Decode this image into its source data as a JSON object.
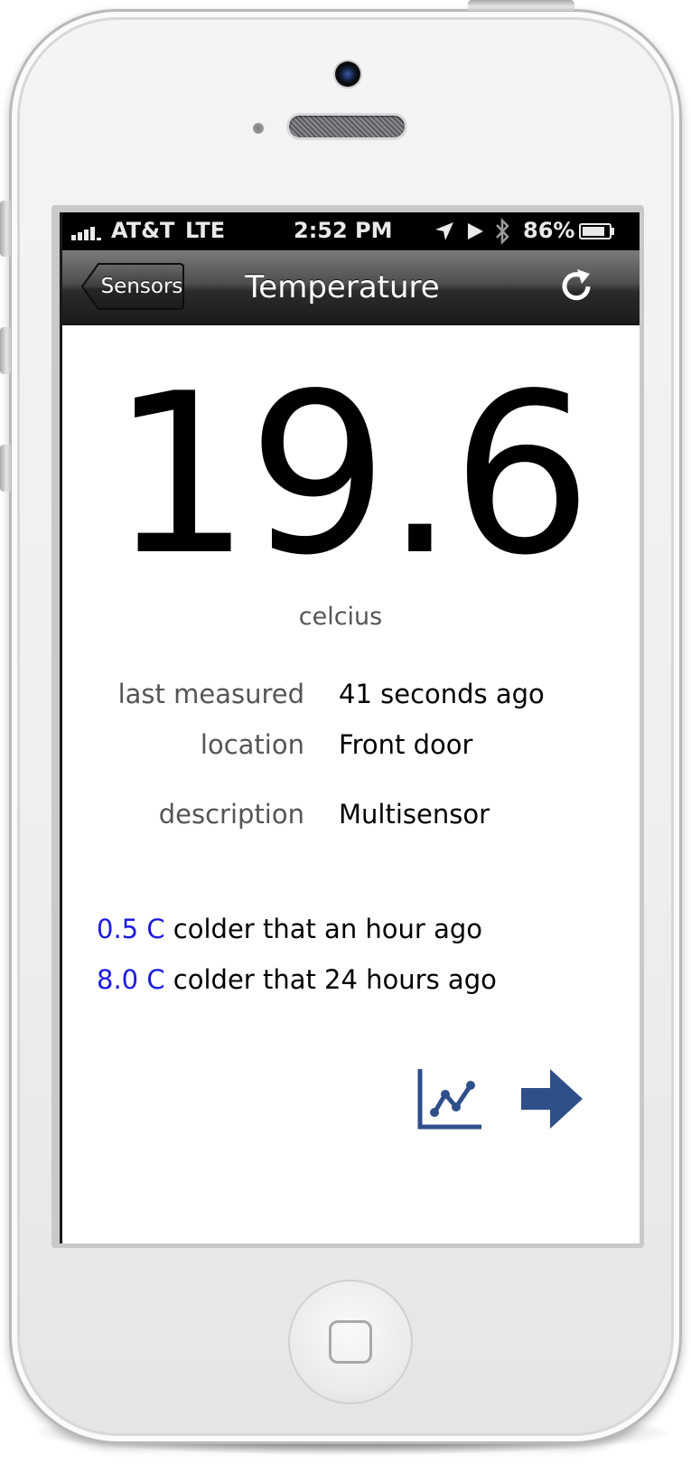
{
  "status_bar": {
    "carrier": "AT&T",
    "network": "LTE",
    "time": "2:52 PM",
    "battery_percent": "86%",
    "battery_level": 0.86,
    "signal_bars": 4,
    "icons": [
      "location-arrow-icon",
      "play-icon",
      "bluetooth-icon",
      "battery-icon"
    ]
  },
  "nav": {
    "back_label": "Sensors",
    "title": "Temperature",
    "refresh_icon": "refresh-icon"
  },
  "sensor": {
    "value": "19.6",
    "unit": "celcius",
    "details": [
      {
        "label": "last measured",
        "value": "41 seconds ago"
      },
      {
        "label": "location",
        "value": "Front door"
      },
      {
        "label": "description",
        "value": "Multisensor"
      }
    ],
    "comparisons": [
      {
        "delta": "0.5 C",
        "text": " colder that an hour ago"
      },
      {
        "delta": "8.0 C",
        "text": " colder that 24 hours ago"
      }
    ]
  },
  "actions": {
    "chart_icon": "line-chart-icon",
    "next_icon": "arrow-right-icon"
  },
  "colors": {
    "accent_blue": "#1a1ae0",
    "icon_blue": "#2f4f8a",
    "nav_dark": "#1a1a1b"
  }
}
